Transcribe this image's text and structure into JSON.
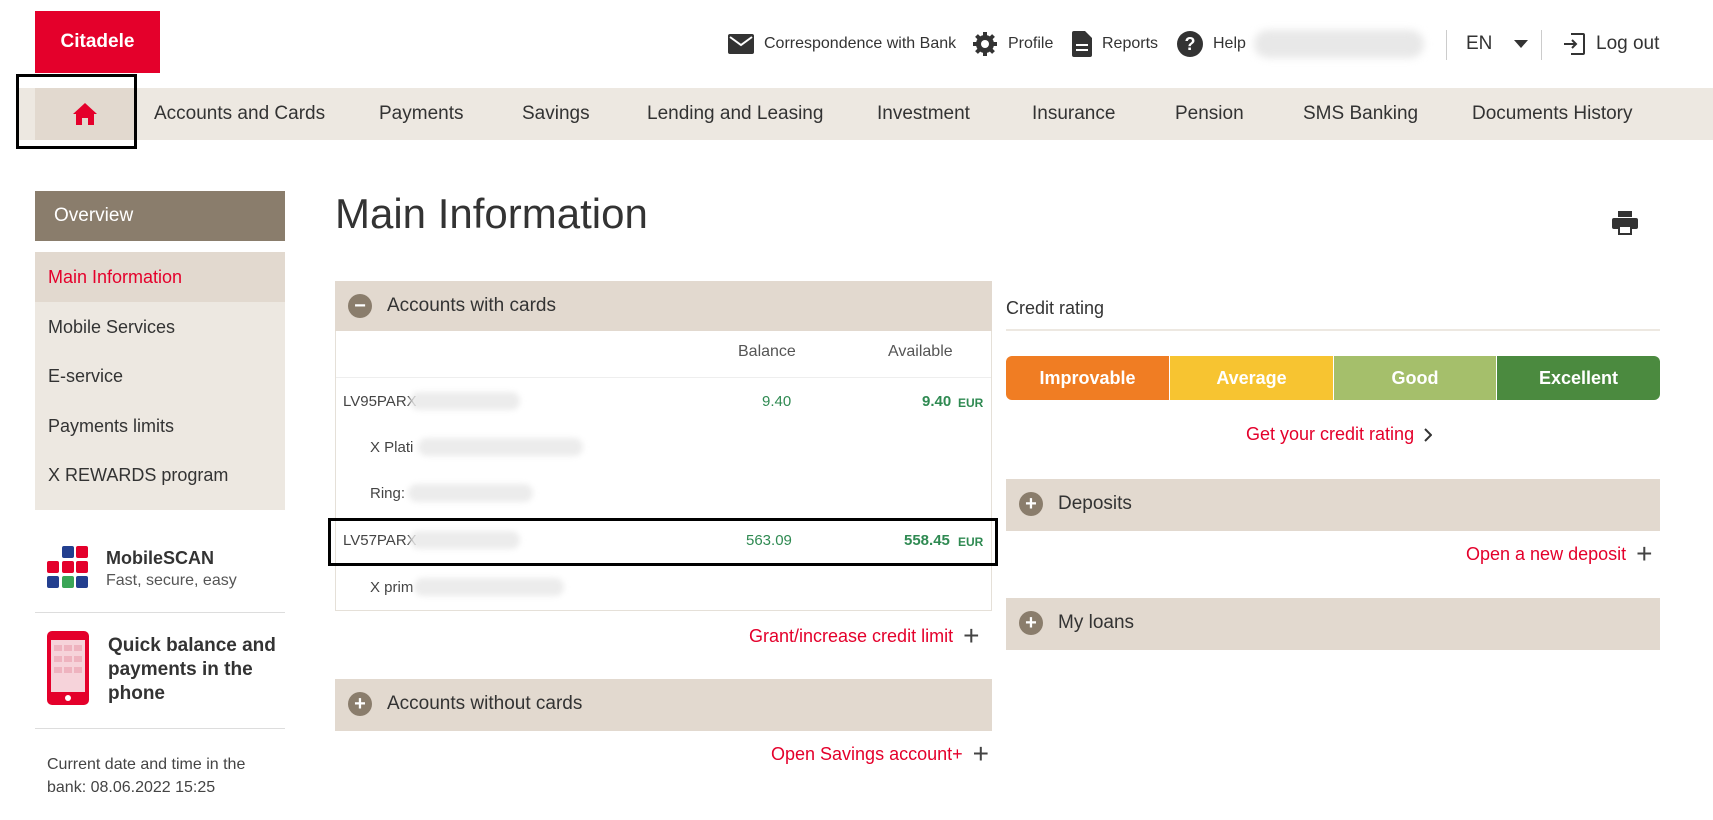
{
  "header": {
    "logo": "Citadele",
    "links": {
      "correspondence": "Correspondence with Bank",
      "profile": "Profile",
      "reports": "Reports",
      "help": "Help",
      "language": "EN",
      "logout": "Log out"
    }
  },
  "nav": {
    "items": [
      "Accounts and Cards",
      "Payments",
      "Savings",
      "Lending and Leasing",
      "Investment",
      "Insurance",
      "Pension",
      "SMS Banking",
      "Documents History"
    ]
  },
  "sidebar": {
    "header": "Overview",
    "items": [
      "Main Information",
      "Mobile Services",
      "E-service",
      "Payments limits",
      "X REWARDS program"
    ],
    "promo_scan": {
      "title": "MobileSCAN",
      "subtitle": "Fast, secure, easy"
    },
    "promo_phone": {
      "title": "Quick balance and payments in the phone"
    },
    "datetime": "Current date and time in the bank: 08.06.2022 15:25"
  },
  "main": {
    "title": "Main Information",
    "accounts_with_cards": {
      "title": "Accounts with cards",
      "col_balance": "Balance",
      "col_available": "Available",
      "rows": [
        {
          "account": "LV95PARX",
          "balance": "9.40",
          "available": "9.40",
          "currency": "EUR"
        },
        {
          "card": "X Plati"
        },
        {
          "card": "Ring:"
        },
        {
          "account": "LV57PARX",
          "balance": "563.09",
          "available": "558.45",
          "currency": "EUR"
        },
        {
          "card": "X prim"
        }
      ],
      "link": "Grant/increase credit limit"
    },
    "accounts_without_cards": {
      "title": "Accounts without cards",
      "link": "Open Savings account+"
    }
  },
  "credit": {
    "title": "Credit rating",
    "segments": [
      {
        "label": "Improvable",
        "color": "#f07d23"
      },
      {
        "label": "Average",
        "color": "#f7c431"
      },
      {
        "label": "Good",
        "color": "#a5bf6b"
      },
      {
        "label": "Excellent",
        "color": "#4b8a3f"
      }
    ],
    "link": "Get your credit rating",
    "deposits": {
      "title": "Deposits",
      "link": "Open a new deposit"
    },
    "loans": {
      "title": "My loans"
    }
  }
}
